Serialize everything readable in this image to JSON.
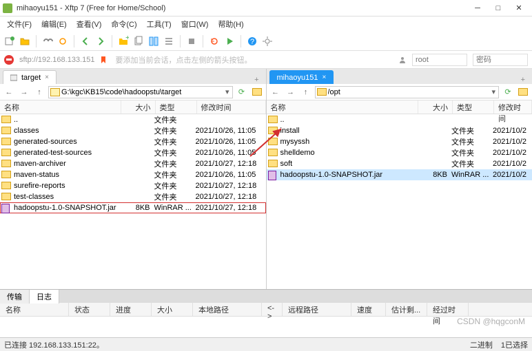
{
  "title": "mihaoyu151 - Xftp 7 (Free for Home/School)",
  "menu": [
    "文件(F)",
    "编辑(E)",
    "查看(V)",
    "命令(C)",
    "工具(T)",
    "窗口(W)",
    "帮助(H)"
  ],
  "addressbar": {
    "sftp": "sftp://192.168.133.151",
    "hint": "要添加当前会话，点击左侧的箭头按钮。",
    "user_placeholder": "root",
    "pass_placeholder": "密码"
  },
  "left": {
    "tab": "target",
    "path": "G:\\kgc\\KB15\\code\\hadoopstu\\target",
    "headers": {
      "name": "名称",
      "size": "大小",
      "type": "类型",
      "date": "修改时间"
    },
    "rows": [
      {
        "icon": "folder",
        "name": "..",
        "size": "",
        "type": "文件夹",
        "date": ""
      },
      {
        "icon": "folder",
        "name": "classes",
        "size": "",
        "type": "文件夹",
        "date": "2021/10/26, 11:05"
      },
      {
        "icon": "folder",
        "name": "generated-sources",
        "size": "",
        "type": "文件夹",
        "date": "2021/10/26, 11:05"
      },
      {
        "icon": "folder",
        "name": "generated-test-sources",
        "size": "",
        "type": "文件夹",
        "date": "2021/10/26, 11:05"
      },
      {
        "icon": "folder",
        "name": "maven-archiver",
        "size": "",
        "type": "文件夹",
        "date": "2021/10/27, 12:18"
      },
      {
        "icon": "folder",
        "name": "maven-status",
        "size": "",
        "type": "文件夹",
        "date": "2021/10/26, 11:05"
      },
      {
        "icon": "folder",
        "name": "surefire-reports",
        "size": "",
        "type": "文件夹",
        "date": "2021/10/27, 12:18"
      },
      {
        "icon": "folder",
        "name": "test-classes",
        "size": "",
        "type": "文件夹",
        "date": "2021/10/27, 12:18"
      },
      {
        "icon": "jar",
        "name": "hadoopstu-1.0-SNAPSHOT.jar",
        "size": "8KB",
        "type": "WinRAR ...",
        "date": "2021/10/27, 12:18",
        "boxed": true
      }
    ]
  },
  "right": {
    "tab": "mihaoyu151",
    "path": "/opt",
    "headers": {
      "name": "名称",
      "size": "大小",
      "type": "类型",
      "date": "修改时间"
    },
    "rows": [
      {
        "icon": "folder",
        "name": "..",
        "size": "",
        "type": "",
        "date": ""
      },
      {
        "icon": "folder",
        "name": "install",
        "size": "",
        "type": "文件夹",
        "date": "2021/10/2"
      },
      {
        "icon": "folder",
        "name": "mysyssh",
        "size": "",
        "type": "文件夹",
        "date": "2021/10/2"
      },
      {
        "icon": "folder",
        "name": "shelldemo",
        "size": "",
        "type": "文件夹",
        "date": "2021/10/2"
      },
      {
        "icon": "folder",
        "name": "soft",
        "size": "",
        "type": "文件夹",
        "date": "2021/10/2"
      },
      {
        "icon": "jar",
        "name": "hadoopstu-1.0-SNAPSHOT.jar",
        "size": "8KB",
        "type": "WinRAR ...",
        "date": "2021/10/2",
        "selected": true
      }
    ]
  },
  "bottom": {
    "tabs": [
      "传输",
      "日志"
    ],
    "headers": [
      "名称",
      "状态",
      "进度",
      "大小",
      "本地路径",
      "<->",
      "远程路径",
      "速度",
      "估计剩...",
      "经过时间"
    ]
  },
  "status": {
    "left": "已连接 192.168.133.151:22。",
    "binary": "二进制",
    "count": "1已选择"
  },
  "watermark": "CSDN @hqgconM"
}
